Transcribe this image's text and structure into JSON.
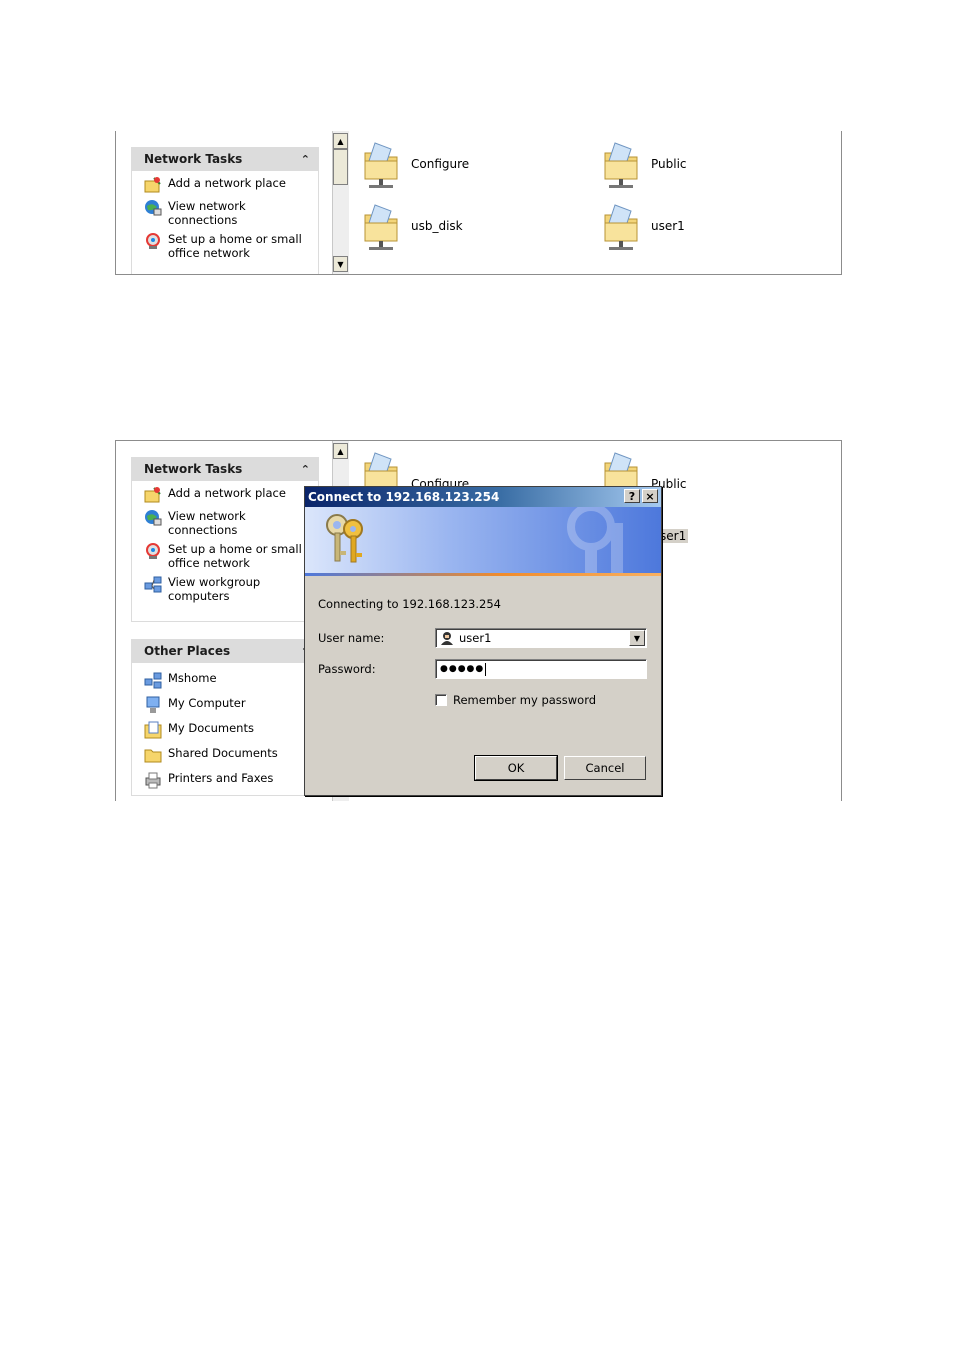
{
  "screen1": {
    "network_tasks": {
      "title": "Network Tasks",
      "items": [
        {
          "label": "Add a network place",
          "icon": "add-network-place-icon"
        },
        {
          "label": "View network\nconnections",
          "icon": "network-connections-icon"
        },
        {
          "label": "Set up a home or small\noffice network",
          "icon": "home-network-icon"
        }
      ]
    },
    "shares": [
      {
        "label": "Configure"
      },
      {
        "label": "Public"
      },
      {
        "label": "usb_disk"
      },
      {
        "label": "user1"
      }
    ]
  },
  "screen2": {
    "network_tasks": {
      "title": "Network Tasks",
      "items": [
        {
          "label": "Add a network place",
          "icon": "add-network-place-icon"
        },
        {
          "label": "View network\nconnections",
          "icon": "network-connections-icon"
        },
        {
          "label": "Set up a home or small\noffice network",
          "icon": "home-network-icon"
        },
        {
          "label": "View workgroup\ncomputers",
          "icon": "workgroup-icon"
        }
      ]
    },
    "other_places": {
      "title": "Other Places",
      "items": [
        {
          "label": "Mshome",
          "icon": "workgroup-icon"
        },
        {
          "label": "My Computer",
          "icon": "computer-icon"
        },
        {
          "label": "My Documents",
          "icon": "documents-icon"
        },
        {
          "label": "Shared Documents",
          "icon": "folder-icon"
        },
        {
          "label": "Printers and Faxes",
          "icon": "printer-icon"
        }
      ]
    },
    "shares": [
      {
        "label": "Configure"
      },
      {
        "label": "Public"
      },
      {
        "label": "ser1"
      }
    ],
    "dialog": {
      "title": "Connect to 192.168.123.254",
      "help_label": "?",
      "close_label": "×",
      "connecting_text": "Connecting to 192.168.123.254",
      "username_label": "User name:",
      "username_value": "user1",
      "password_label": "Password:",
      "password_value": "●●●●●",
      "remember_label": "Remember my password",
      "remember_checked": false,
      "ok_label": "OK",
      "cancel_label": "Cancel"
    }
  }
}
